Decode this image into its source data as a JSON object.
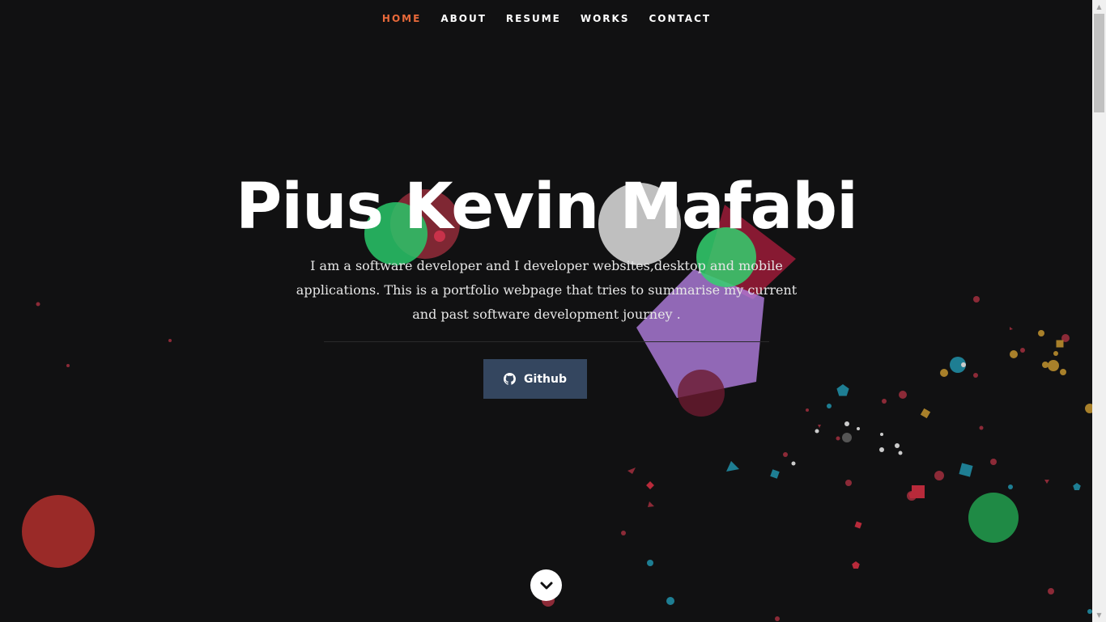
{
  "nav": {
    "items": [
      {
        "label": "HOME",
        "active": true
      },
      {
        "label": "ABOUT",
        "active": false
      },
      {
        "label": "RESUME",
        "active": false
      },
      {
        "label": "WORKS",
        "active": false
      },
      {
        "label": "CONTACT",
        "active": false
      }
    ]
  },
  "hero": {
    "title": "Pius Kevin Mafabi",
    "description": "I am a software developer and I developer websites,desktop and mobile applications. This is a portfolio webpage that tries to summarise my current and past software development journey .",
    "github_label": "Github"
  },
  "icons": {
    "github": "github-icon",
    "scroll_down": "chevron-down-icon"
  },
  "colors": {
    "background": "#111112",
    "accent": "#e8693a",
    "button": "#34465f",
    "text": "#ffffff"
  }
}
